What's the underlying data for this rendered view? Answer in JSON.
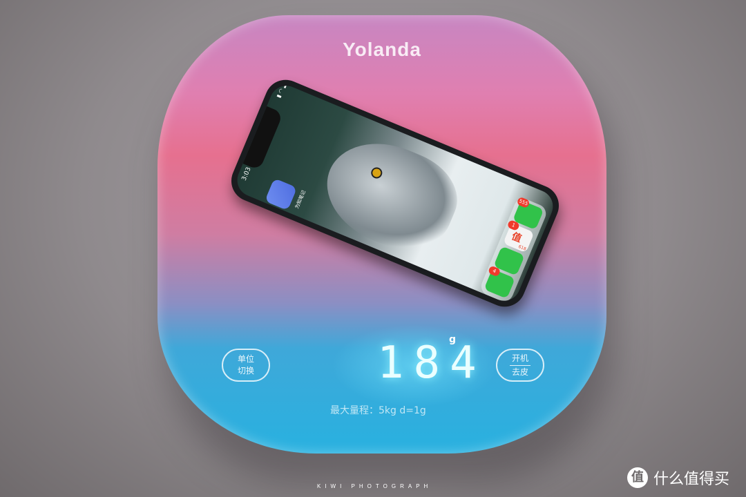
{
  "scale": {
    "brand": "Yolanda",
    "reading": "184",
    "unit": "g",
    "left_button": [
      "单位",
      "切换"
    ],
    "right_button": [
      "开机",
      "去皮"
    ],
    "capacity_label": "最大量程：5kg d=1g",
    "colors": {
      "top": "#c786c2",
      "pink": "#e6708f",
      "blue": "#28b1e0",
      "display": "#eaffff"
    }
  },
  "phone": {
    "time": "3:03",
    "app_label": "为知笔记",
    "dock": [
      {
        "icon": "wechat-icon",
        "badge": "555"
      },
      {
        "icon": "smzdm-icon",
        "badge": "1",
        "text": "值",
        "sub": "618"
      },
      {
        "icon": "phone-icon",
        "badge": ""
      },
      {
        "icon": "messages-icon",
        "badge": "4"
      }
    ]
  },
  "watermark": {
    "photographer": "KIWI  PHOTOGRAPH",
    "logo_glyph": "值",
    "site": "什么值得买"
  }
}
